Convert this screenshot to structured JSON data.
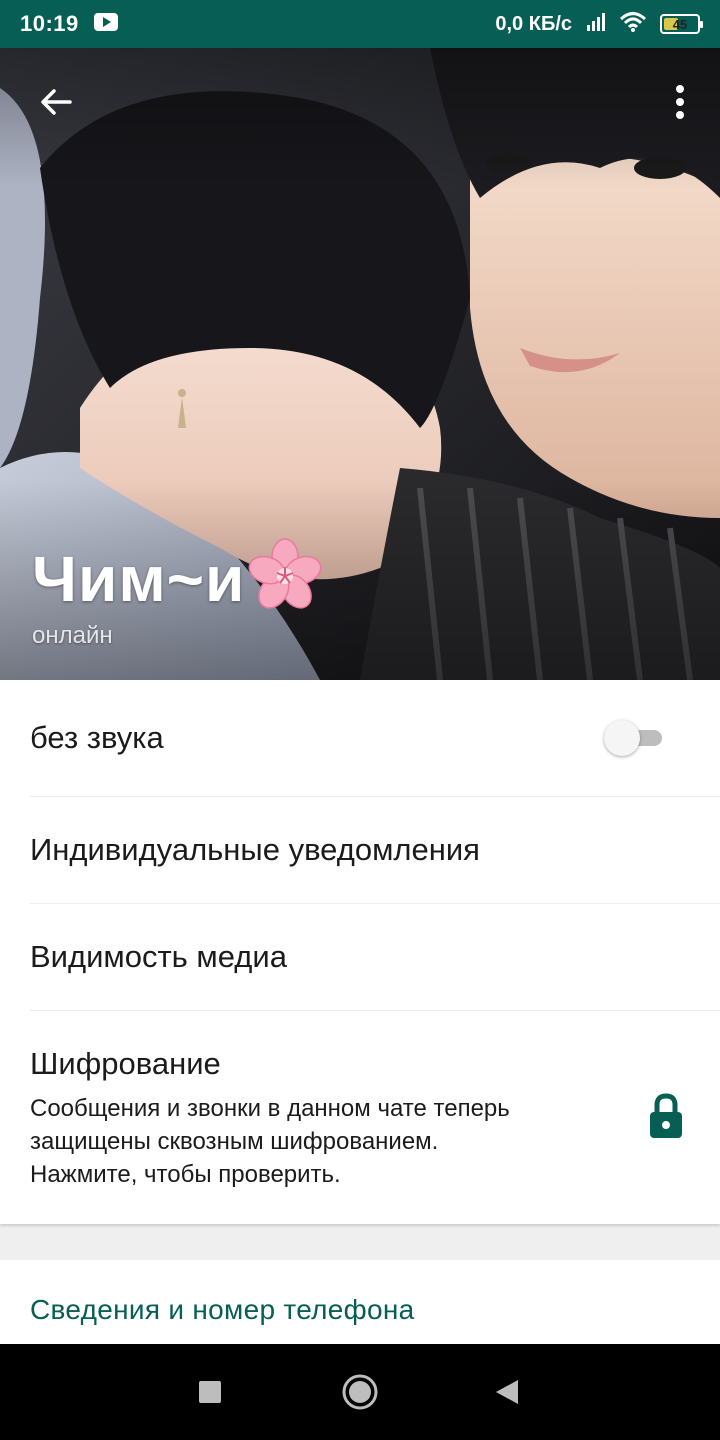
{
  "status_bar": {
    "time": "10:19",
    "network_speed": "0,0 КБ/с",
    "battery_level": "45",
    "battery_fraction": 0.45,
    "icons": [
      "youtube-icon",
      "signal-icon",
      "wifi-icon",
      "battery-icon"
    ]
  },
  "header": {
    "contact_name": "Чим~и",
    "status": "онлайн",
    "icons": [
      "back-arrow-icon",
      "more-vert-icon",
      "sakura-flower-icon"
    ]
  },
  "settings": {
    "mute_label": "без звука",
    "mute_enabled": false,
    "custom_notifications_label": "Индивидуальные уведомления",
    "media_visibility_label": "Видимость медиа",
    "encryption": {
      "title": "Шифрование",
      "line1": "Сообщения и звонки в данном чате теперь",
      "line2": "защищены сквозным шифрованием.",
      "line3": "Нажмите, чтобы проверить.",
      "icon": "lock-icon"
    }
  },
  "info": {
    "title": "Сведения и номер телефона"
  },
  "colors": {
    "accent": "#075e54",
    "toggle_off_track": "#bdbdbd",
    "background": "#f0eff0"
  }
}
